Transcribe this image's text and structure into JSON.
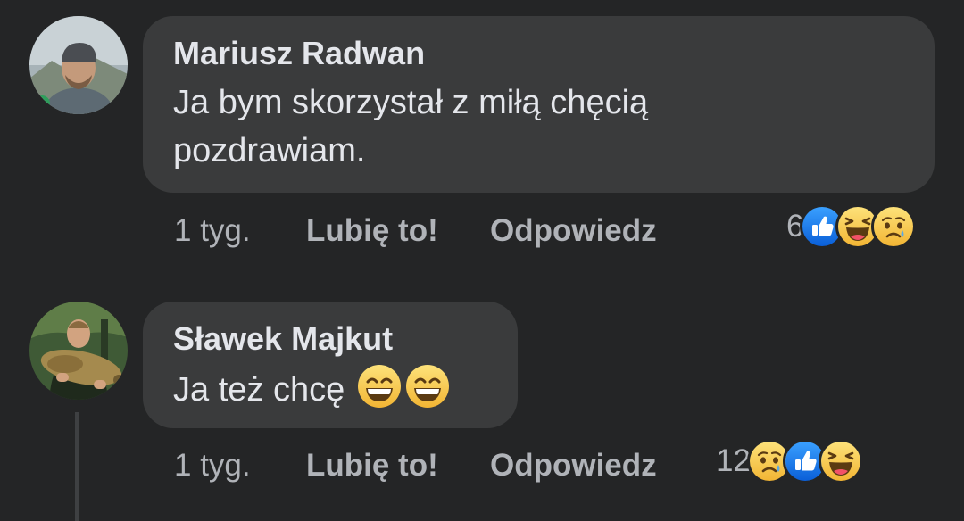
{
  "comments": [
    {
      "author": "Mariusz Radwan",
      "text": "Ja bym skorzystał z miłą chęcią\npozdrawiam.",
      "time": "1 tyg.",
      "like_label": "Lubię to!",
      "reply_label": "Odpowiedz",
      "reaction_count": "6",
      "reactions": [
        "like-icon",
        "haha-icon",
        "sad-icon"
      ]
    },
    {
      "author": "Sławek Majkut",
      "text": "Ja też chcę",
      "inline_emojis": [
        "grinning-face-icon",
        "grinning-face-icon"
      ],
      "time": "1 tyg.",
      "like_label": "Lubię to!",
      "reply_label": "Odpowiedz",
      "reaction_count": "12",
      "reactions": [
        "sad-icon",
        "like-icon",
        "haha-icon"
      ]
    }
  ],
  "colors": {
    "background": "#242526",
    "bubble": "#3a3b3c",
    "text": "#e4e6eb",
    "secondary_text": "#b0b3b8",
    "like_blue": "#1877f2",
    "emoji_yellow": "#f7c94b"
  }
}
